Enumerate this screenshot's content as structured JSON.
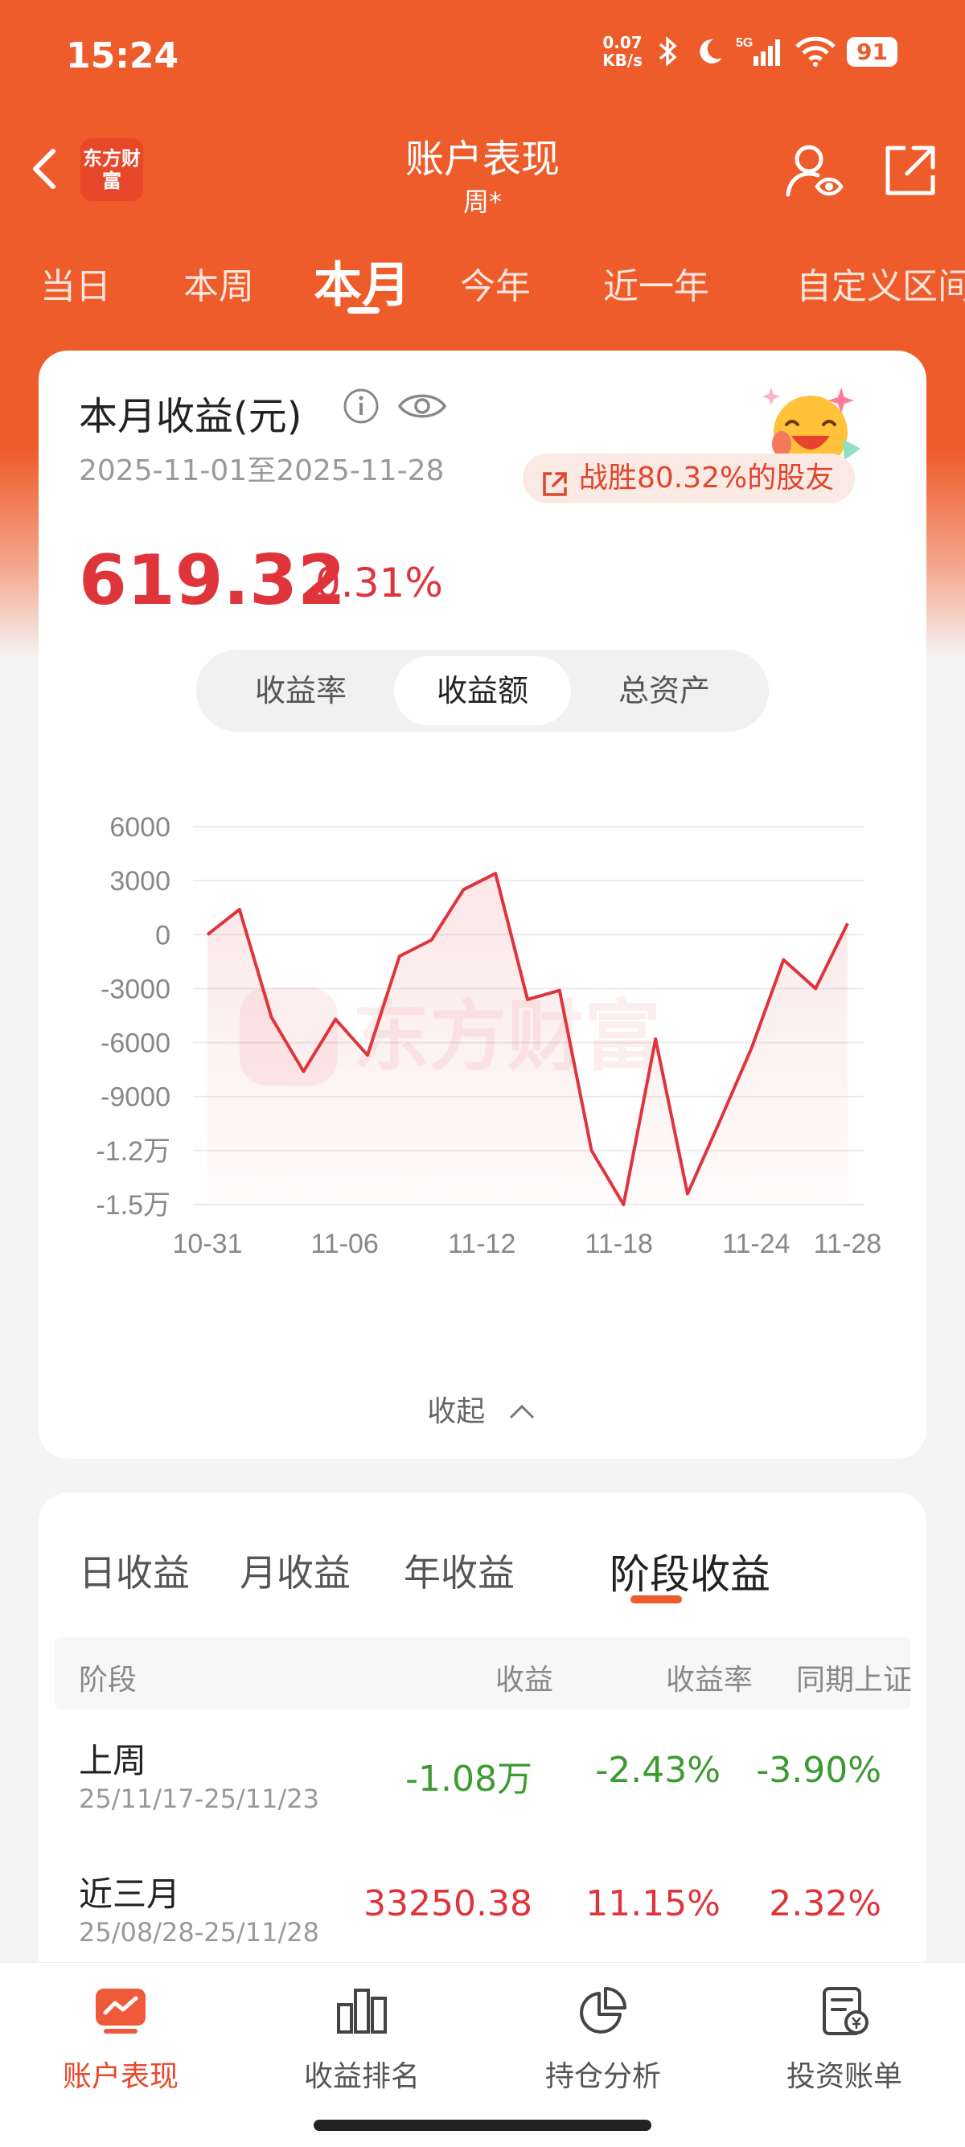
{
  "status": {
    "time": "15:24",
    "net_speed_value": "0.07",
    "net_speed_unit": "KB/s",
    "network": "5G",
    "battery": "91"
  },
  "header": {
    "logo_text": "东方财富",
    "title": "账户表现",
    "subtitle": "周*"
  },
  "tabs": [
    {
      "label": "当日"
    },
    {
      "label": "本周"
    },
    {
      "label": "本月",
      "active": true
    },
    {
      "label": "今年"
    },
    {
      "label": "近一年"
    },
    {
      "label": "自定义区间"
    }
  ],
  "summary": {
    "title": "本月收益(元)",
    "date_range": "2025-11-01至2025-11-28",
    "badge": "战胜80.32%的股友",
    "amount": "619.32",
    "percent": "0.31%",
    "segments": [
      "收益率",
      "收益额",
      "总资产"
    ],
    "active_segment": "收益额",
    "collapse_label": "收起"
  },
  "chart_data": {
    "type": "area",
    "x": [
      "10-31",
      "11-01",
      "11-02",
      "11-03",
      "11-04",
      "11-05",
      "11-06",
      "11-07",
      "11-08",
      "11-09",
      "11-10",
      "11-11",
      "11-12",
      "11-13",
      "11-14",
      "11-15",
      "11-16",
      "11-17",
      "11-18",
      "11-19",
      "11-20",
      "11-21",
      "11-22",
      "11-23",
      "11-24",
      "11-25",
      "11-26",
      "11-27",
      "11-28"
    ],
    "y": [
      0,
      1400,
      -4600,
      -7600,
      -4700,
      -6700,
      -1200,
      -300,
      2500,
      3400,
      -3600,
      -3100,
      -12000,
      -15000,
      -5800,
      -14400,
      -10400,
      -6300,
      -1400,
      -3000,
      619.32
    ],
    "x_ticks": [
      "10-31",
      "11-06",
      "11-12",
      "11-18",
      "11-24",
      "11-28"
    ],
    "y_ticks": [
      "6000",
      "3000",
      "0",
      "-3000",
      "-6000",
      "-9000",
      "-1.2万",
      "-1.5万"
    ],
    "y_tick_values": [
      6000,
      3000,
      0,
      -3000,
      -6000,
      -9000,
      -12000,
      -15000
    ],
    "ylim": [
      -15000,
      6000
    ],
    "watermark": "东方财富",
    "line_color": "#e0343b",
    "grid": true
  },
  "period": {
    "subtabs": [
      "日收益",
      "月收益",
      "年收益",
      "阶段收益"
    ],
    "active_subtab": "阶段收益",
    "headers": {
      "stage": "阶段",
      "profit": "收益",
      "rate": "收益率",
      "index": "同期上证"
    },
    "rows": [
      {
        "name": "上周",
        "range": "25/11/17-25/11/23",
        "profit": "-1.08万",
        "rate": "-2.43%",
        "index": "-3.90%",
        "tone": "green"
      },
      {
        "name": "近三月",
        "range": "25/08/28-25/11/28",
        "profit": "33250.38",
        "rate": "11.15%",
        "index": "2.32%",
        "tone": "red"
      }
    ]
  },
  "bottom_nav": [
    {
      "label": "账户表现",
      "icon": "chart-screen-icon",
      "active": true
    },
    {
      "label": "收益排名",
      "icon": "bar-ranking-icon"
    },
    {
      "label": "持仓分析",
      "icon": "pie-chart-icon"
    },
    {
      "label": "投资账单",
      "icon": "bill-icon"
    }
  ],
  "colors": {
    "brand": "#ee5c2b",
    "up": "#e0343b",
    "down": "#3b9b2f"
  }
}
